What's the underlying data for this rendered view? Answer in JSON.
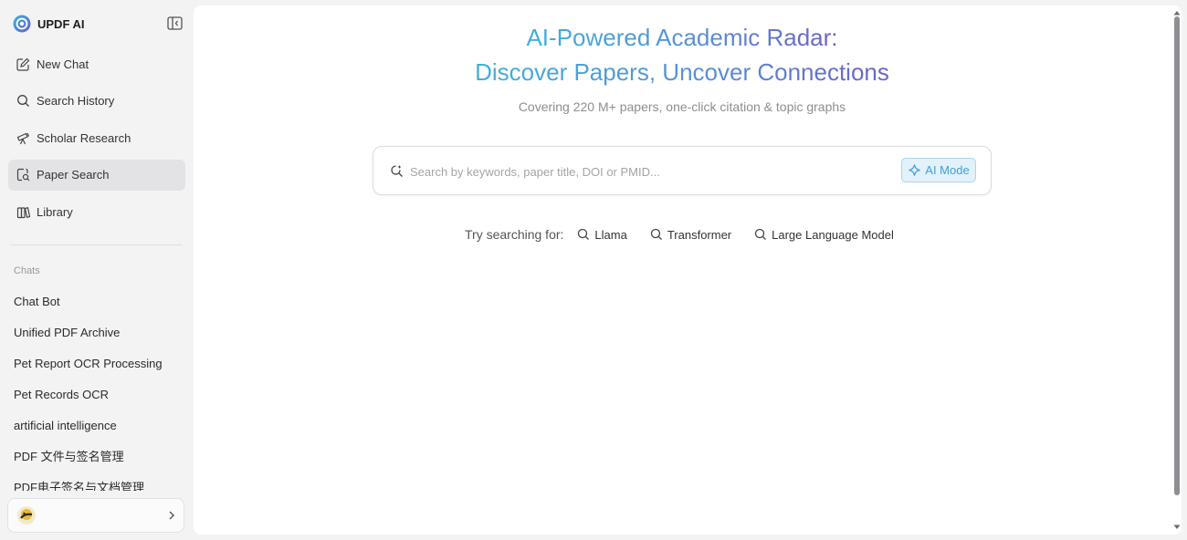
{
  "brand": {
    "name": "UPDF AI"
  },
  "nav": [
    {
      "label": "New Chat",
      "icon": "edit-icon"
    },
    {
      "label": "Search History",
      "icon": "search-icon"
    },
    {
      "label": "Scholar Research",
      "icon": "telescope-icon"
    },
    {
      "label": "Paper Search",
      "icon": "doc-search-icon",
      "active": true
    },
    {
      "label": "Library",
      "icon": "library-icon"
    }
  ],
  "chats": {
    "label": "Chats",
    "items": [
      "Chat Bot",
      "Unified PDF Archive",
      "Pet Report OCR Processing",
      "Pet Records OCR",
      "artificial intelligence",
      "PDF 文件与签名管理",
      "PDF电子签名与文档管理"
    ]
  },
  "main": {
    "headline_line1": "AI-Powered Academic Radar:",
    "headline_line2": "Discover Papers, Uncover Connections",
    "subtitle": "Covering 220 M+ papers, one-click citation & topic graphs",
    "search": {
      "placeholder": "Search by keywords, paper title, DOI or PMID...",
      "value": "",
      "ai_mode_label": "AI Mode"
    },
    "suggestions": {
      "label": "Try searching for:",
      "items": [
        "Llama",
        "Transformer",
        "Large Language Model"
      ]
    }
  },
  "colors": {
    "accent": "#3ea0dd",
    "gradient_start": "#3fb0dc",
    "gradient_end": "#6a62c8",
    "active_nav_bg": "#e3e3e6"
  }
}
